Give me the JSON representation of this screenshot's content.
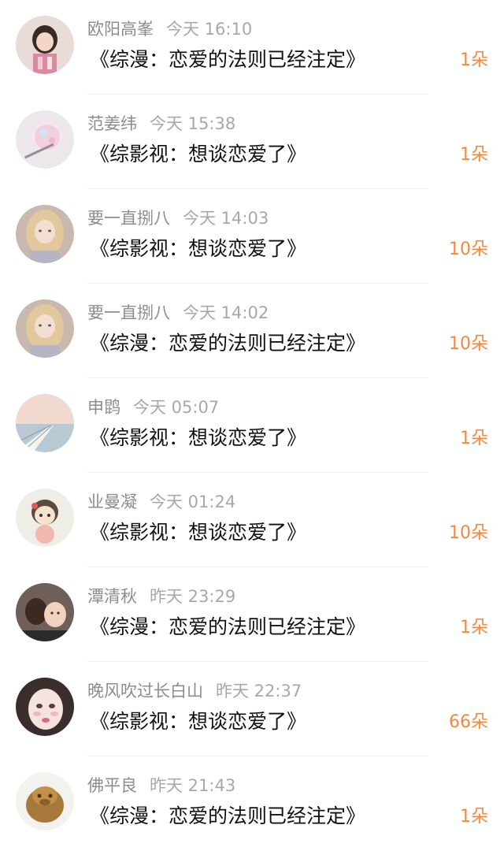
{
  "items": [
    {
      "user": "欧阳高峯",
      "time": "今天 16:10",
      "title": "《综漫：恋爱的法则已经注定》",
      "amount": "1朵"
    },
    {
      "user": "范姜纬",
      "time": "今天 15:38",
      "title": "《综影视：想谈恋爱了》",
      "amount": "1朵"
    },
    {
      "user": "要一直捌八",
      "time": "今天 14:03",
      "title": "《综影视：想谈恋爱了》",
      "amount": "10朵"
    },
    {
      "user": "要一直捌八",
      "time": "今天 14:02",
      "title": "《综漫：恋爱的法则已经注定》",
      "amount": "10朵"
    },
    {
      "user": "申鹍",
      "time": "今天 05:07",
      "title": "《综影视：想谈恋爱了》",
      "amount": "1朵"
    },
    {
      "user": "业曼凝",
      "time": "今天 01:24",
      "title": "《综影视：想谈恋爱了》",
      "amount": "10朵"
    },
    {
      "user": "潭清秋",
      "time": "昨天 23:29",
      "title": "《综漫：恋爱的法则已经注定》",
      "amount": "1朵"
    },
    {
      "user": "晚风吹过长白山",
      "time": "昨天 22:37",
      "title": "《综影视：想谈恋爱了》",
      "amount": "66朵"
    },
    {
      "user": "佛平良",
      "time": "昨天 21:43",
      "title": "《综漫：恋爱的法则已经注定》",
      "amount": "1朵"
    }
  ]
}
